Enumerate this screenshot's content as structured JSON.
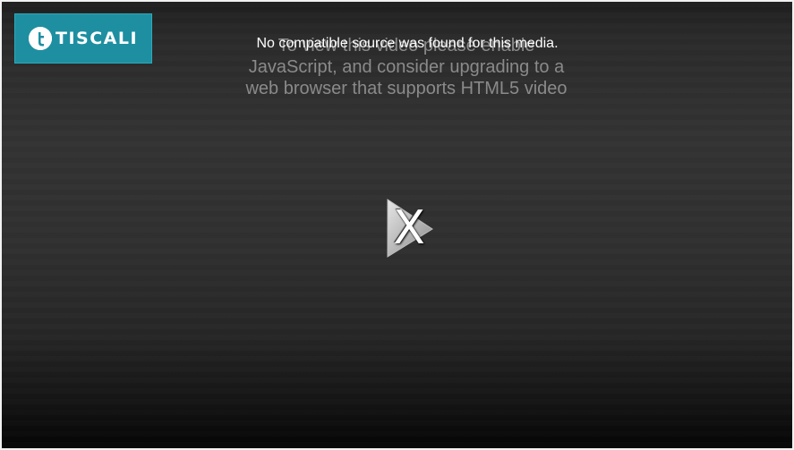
{
  "brand": {
    "name": "TISCALI",
    "mark_letter": "t",
    "color": "#1e8fa1"
  },
  "player": {
    "error_message": "No compatible source was found for this media.",
    "fallback_message": "To view this video please enable JavaScript, and consider upgrading to a web browser that supports HTML5 video",
    "play_icon": "play-triangle-icon",
    "error_glyph": "X"
  }
}
